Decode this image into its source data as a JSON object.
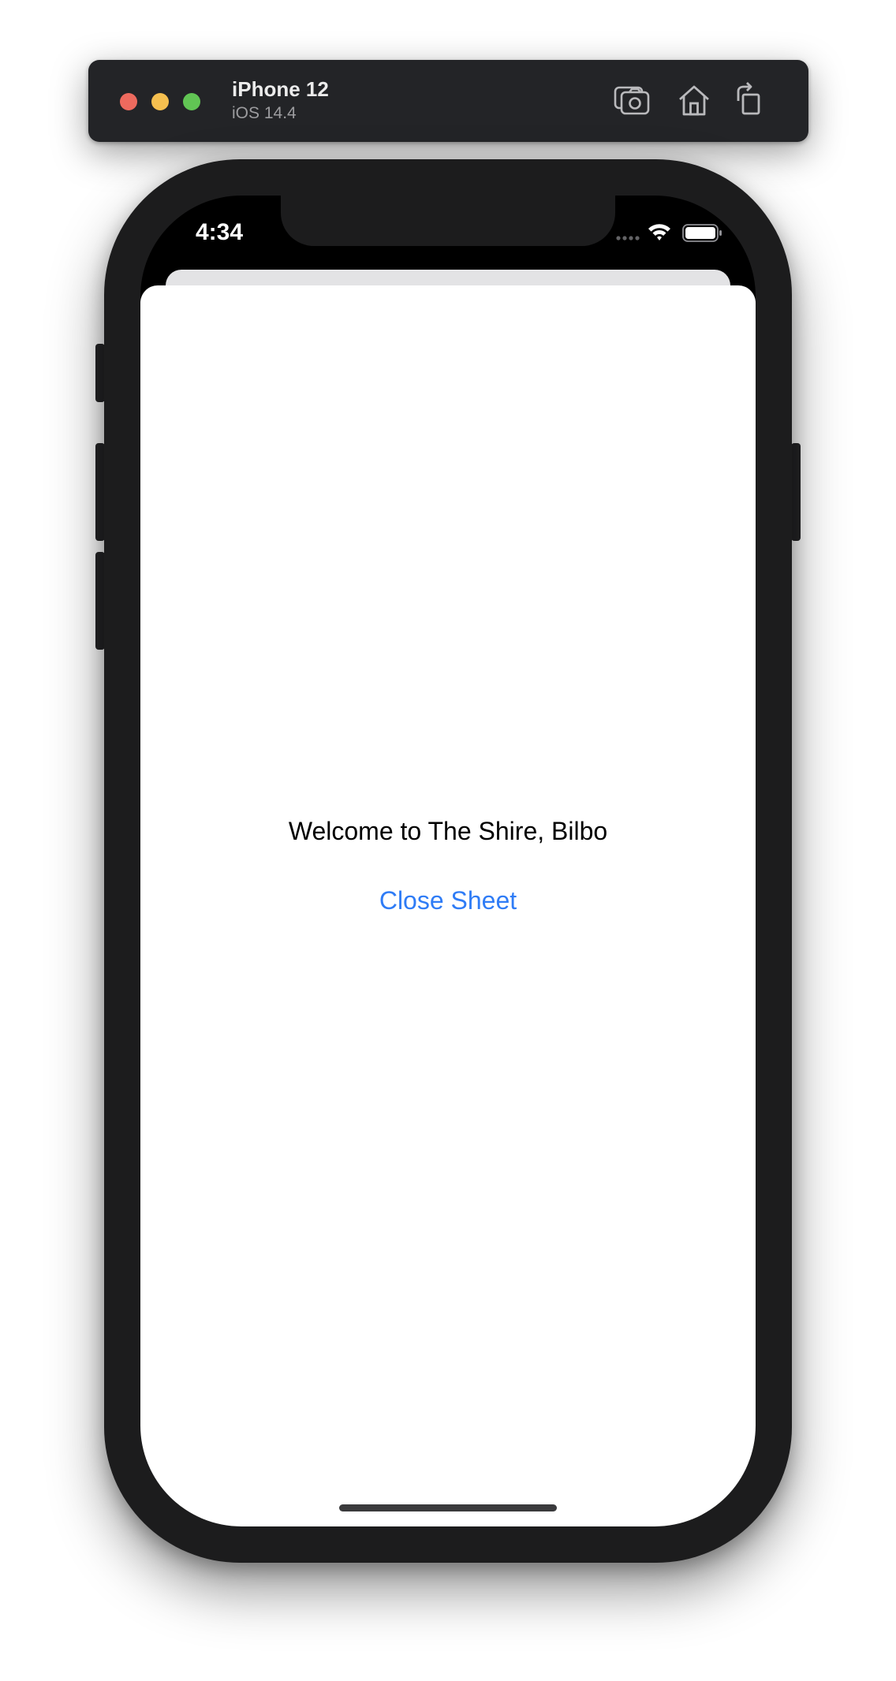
{
  "simulator": {
    "device_name": "iPhone 12",
    "os_version": "iOS 14.4",
    "toolbar_buttons": [
      {
        "icon": "screenshot-icon"
      },
      {
        "icon": "home-icon"
      },
      {
        "icon": "rotate-icon"
      }
    ]
  },
  "status_bar": {
    "time": "4:34",
    "icons": [
      "cellular-icon",
      "wifi-icon",
      "battery-icon"
    ]
  },
  "sheet": {
    "message": "Welcome to The Shire, Bilbo",
    "close_button_label": "Close Sheet"
  },
  "colors": {
    "accent": "#2f7cf6",
    "close_dot": "#ed6a5e",
    "minimize_dot": "#f5bf4f",
    "maximize_dot": "#61c554"
  }
}
